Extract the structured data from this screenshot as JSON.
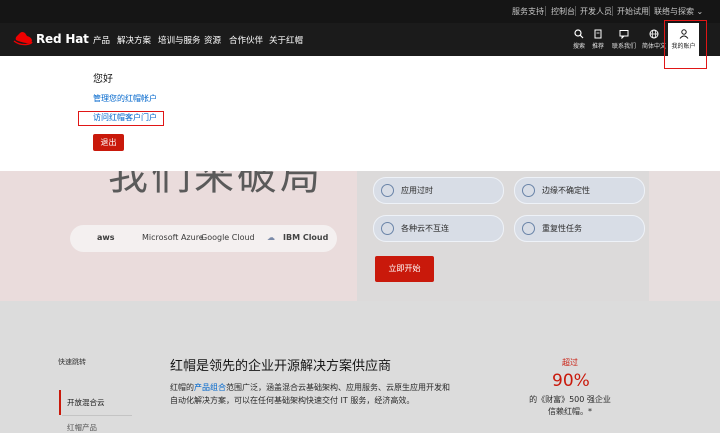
{
  "utility_bar": {
    "links": [
      "服务支持",
      "控制台",
      "开发人员",
      "开始试用"
    ],
    "contact": "联络与探索"
  },
  "nav": {
    "logo_text": "Red Hat",
    "items": [
      "产品",
      "解决方案",
      "培训与服务",
      "资源",
      "合作伙伴",
      "关于红帽"
    ],
    "tools": {
      "search": "搜索",
      "recommend": "推荐",
      "contact": "联系我们",
      "language": "简体中文",
      "account": "我的账户"
    }
  },
  "account_menu": {
    "greeting": "您好",
    "manage_link": "管理您的红帽帐户",
    "portal_link": "访问红帽客户门户",
    "logout": "退出"
  },
  "hero": {
    "title": "我们来破局",
    "clouds": [
      "aws",
      "Microsoft Azure",
      "Google Cloud",
      "IBM Cloud"
    ],
    "features": [
      "应用过时",
      "边缘不确定性",
      "各种云不互连",
      "重复性任务"
    ],
    "cta": "立即开始"
  },
  "section": {
    "quick_jump": "快速跳转",
    "sidebar_items": [
      "开放混合云",
      "红帽产品"
    ],
    "heading": "红帽是领先的企业开源解决方案供应商",
    "para_prefix": "红帽的",
    "para_link": "产品组合",
    "para_rest": "范围广泛，涵盖混合云基础架构、应用服务、云原生应用开发和自动化解决方案，可以在任何基础架构快速交付 IT 服务，经济高效。",
    "stat_pre": "超过",
    "stat_value": "90%",
    "stat_text": "的《财富》500 强企业信赖红帽。*"
  },
  "colors": {
    "brand_red": "#ee0000",
    "button_red": "#c9190b",
    "link_blue": "#0066cc",
    "nav_bg": "#1b1b1b"
  }
}
